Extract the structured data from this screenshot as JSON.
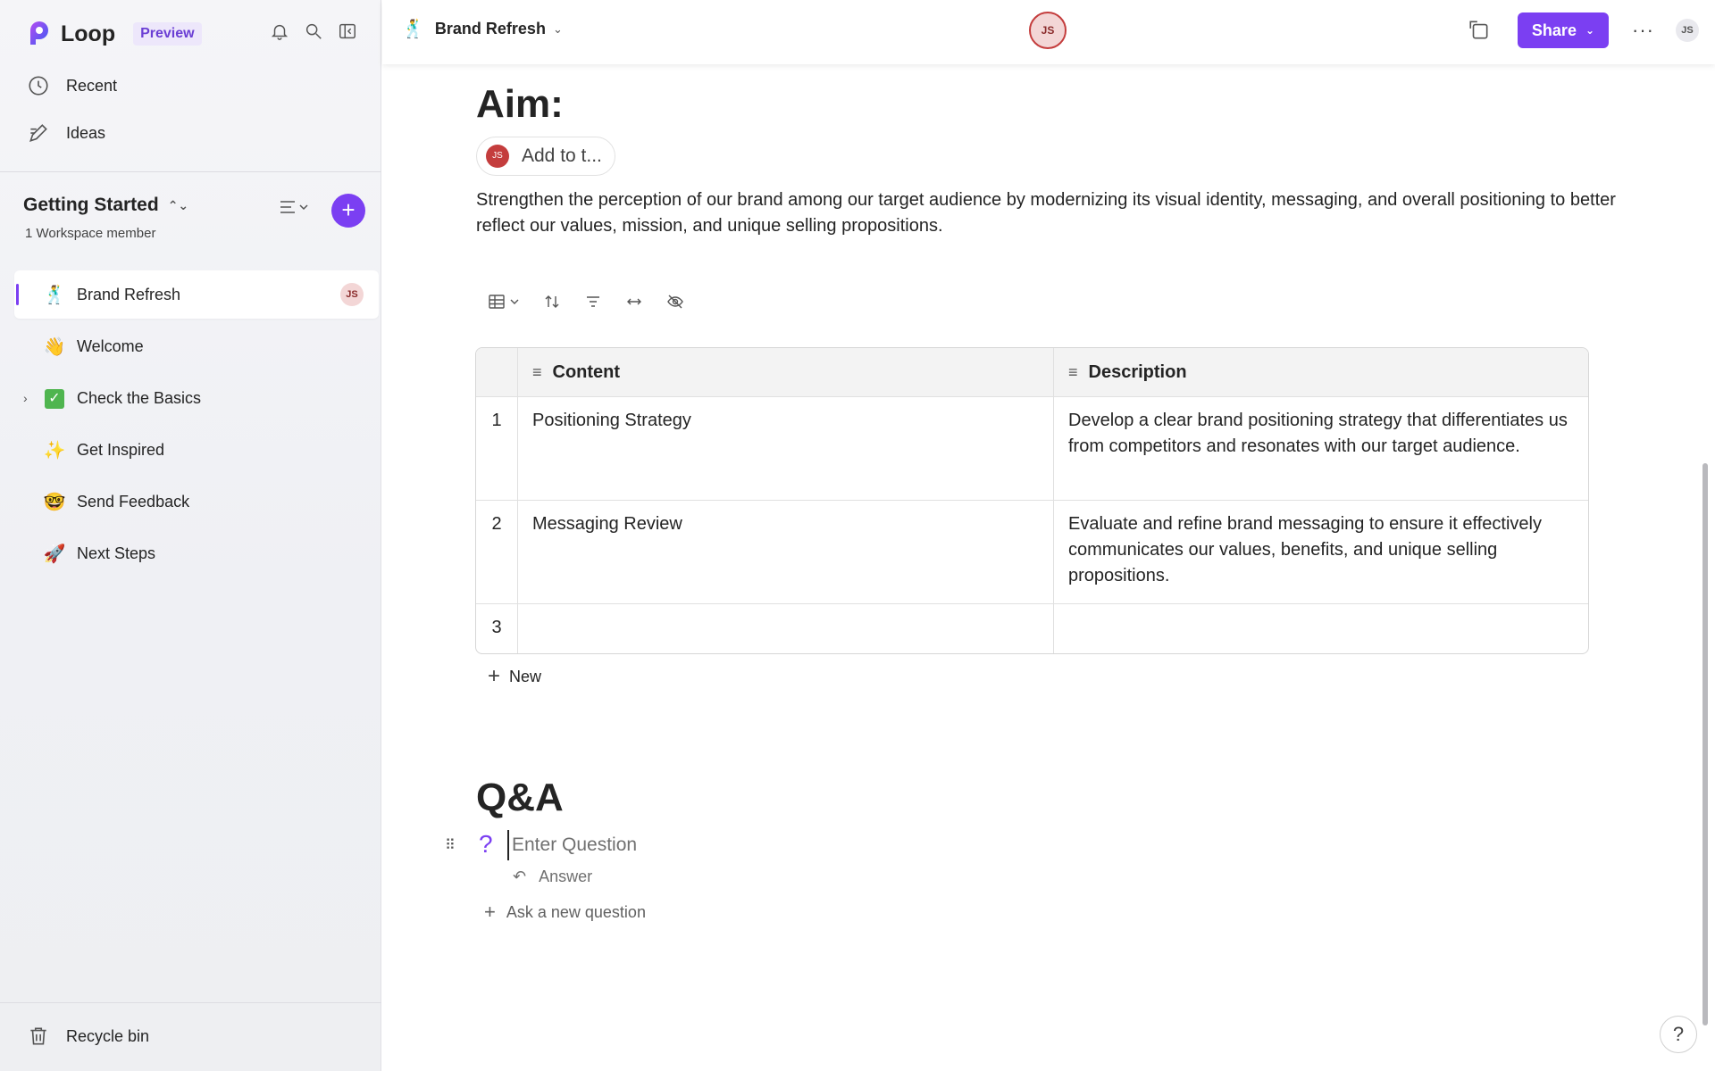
{
  "app": {
    "name": "Loop",
    "badge": "Preview"
  },
  "nav": {
    "recent": "Recent",
    "ideas": "Ideas"
  },
  "workspace": {
    "title": "Getting Started",
    "members": "1 Workspace member",
    "add_symbol": "+"
  },
  "pages": [
    {
      "emoji": "🕺",
      "label": "Brand Refresh",
      "active": true,
      "avatar": "JS"
    },
    {
      "emoji": "👋",
      "label": "Welcome"
    },
    {
      "emoji": "✓",
      "label": "Check the Basics",
      "expandable": true
    },
    {
      "emoji": "✨",
      "label": "Get Inspired"
    },
    {
      "emoji": "🤓",
      "label": "Send Feedback"
    },
    {
      "emoji": "🚀",
      "label": "Next Steps"
    }
  ],
  "recycle_bin": "Recycle bin",
  "header": {
    "doc_emoji": "🕺",
    "doc_title": "Brand Refresh",
    "presence_initials": "JS",
    "share_label": "Share",
    "more_label": "···",
    "user_initials": "JS"
  },
  "doc": {
    "aim_heading": "Aim:",
    "assignee_initials": "JS",
    "assignee_label": "Add to t...",
    "aim_text": "Strengthen the perception of our brand among our target audience by modernizing its visual identity, messaging, and overall positioning to better reflect our values, mission, and unique selling propositions.",
    "table": {
      "headers": [
        "Content",
        "Description"
      ],
      "rows": [
        {
          "num": "1",
          "content": "Positioning Strategy",
          "description": "Develop a clear brand positioning strategy that differentiates us from competitors and resonates with our target audience."
        },
        {
          "num": "2",
          "content": "Messaging Review",
          "description": "Evaluate and refine brand messaging to ensure it effectively communicates our values, benefits, and unique selling propositions."
        },
        {
          "num": "3",
          "content": "",
          "description": ""
        }
      ],
      "new_label": "New"
    },
    "qa_heading": "Q&A",
    "question_placeholder": "Enter Question",
    "answer_label": "Answer",
    "ask_new_label": "Ask a new question"
  },
  "help_label": "?",
  "colors": {
    "accent": "#7b3ff2",
    "avatar_red": "#c43d3d"
  }
}
